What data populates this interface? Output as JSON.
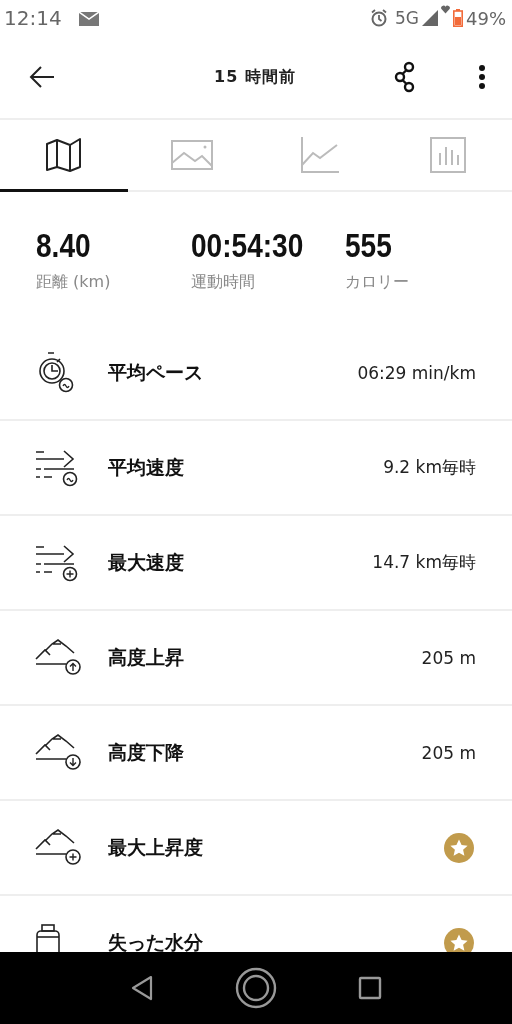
{
  "status_bar": {
    "time": "12:14",
    "network": "5G",
    "battery": "49%"
  },
  "app_bar": {
    "title": "15 時間前"
  },
  "tabs": [
    {
      "selected": true
    },
    {
      "selected": false
    },
    {
      "selected": false
    },
    {
      "selected": false
    }
  ],
  "summary": [
    {
      "value": "8.40",
      "label": "距離 (km)"
    },
    {
      "value": "00:54:30",
      "label": "運動時間"
    },
    {
      "value": "555",
      "label": "カロリー"
    }
  ],
  "metrics": [
    {
      "label": "平均ペース",
      "kind": "value",
      "value": "06:29 min/km"
    },
    {
      "label": "平均速度",
      "kind": "value",
      "value": "9.2 km毎時"
    },
    {
      "label": "最大速度",
      "kind": "value",
      "value": "14.7 km毎時"
    },
    {
      "label": "高度上昇",
      "kind": "value",
      "value": "205 m"
    },
    {
      "label": "高度下降",
      "kind": "value",
      "value": "205 m"
    },
    {
      "label": "最大上昇度",
      "kind": "premium"
    },
    {
      "label": "失った水分",
      "kind": "premium"
    }
  ]
}
